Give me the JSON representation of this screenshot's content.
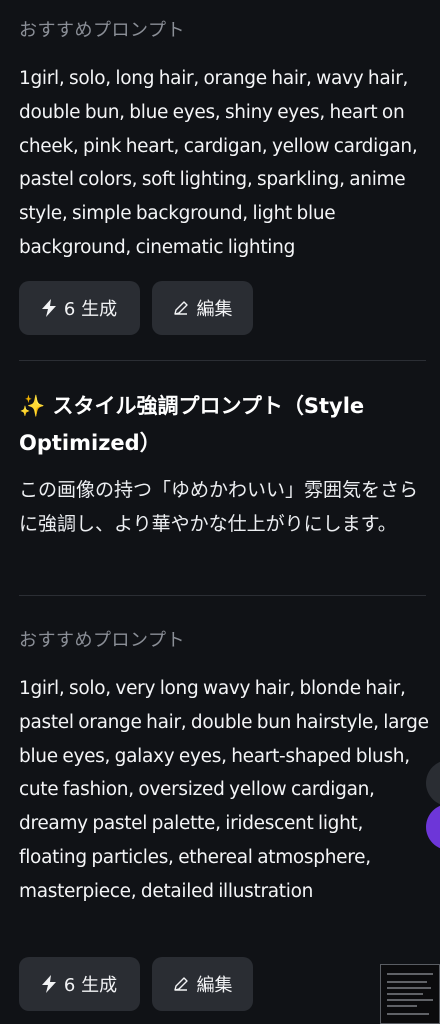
{
  "block1": {
    "label": "おすすめプロンプト",
    "prompt": "1girl, solo, long hair, orange hair, wavy hair, double bun, blue eyes, shiny eyes, heart on cheek, pink heart, cardigan, yellow cardigan, pastel colors, soft lighting, sparkling, anime style, simple background, light blue background, cinematic lighting",
    "generate_label": "6 生成",
    "edit_label": "編集"
  },
  "style_section": {
    "emoji": "✨",
    "title": "スタイル強調プロンプト（Style Optimized）",
    "description": "この画像の持つ「ゆめかわいい」雰囲気をさらに強調し、より華やかな仕上がりにします。"
  },
  "block2": {
    "label": "おすすめプロンプト",
    "prompt": "1girl, solo, very long wavy hair, blonde hair, pastel orange hair, double bun hairstyle, large blue eyes, galaxy eyes, heart-shaped blush, cute fashion, oversized yellow cardigan, dreamy pastel palette, iridescent light, floating particles, ethereal atmosphere, masterpiece, detailed illustration",
    "generate_label": "6 生成",
    "edit_label": "編集"
  },
  "icons": {
    "generate": "lightning-icon",
    "edit": "pencil-icon"
  },
  "colors": {
    "background": "#101216",
    "button": "#2a2d33",
    "label": "#8b8f97",
    "accent_purple": "#7c3aed"
  }
}
